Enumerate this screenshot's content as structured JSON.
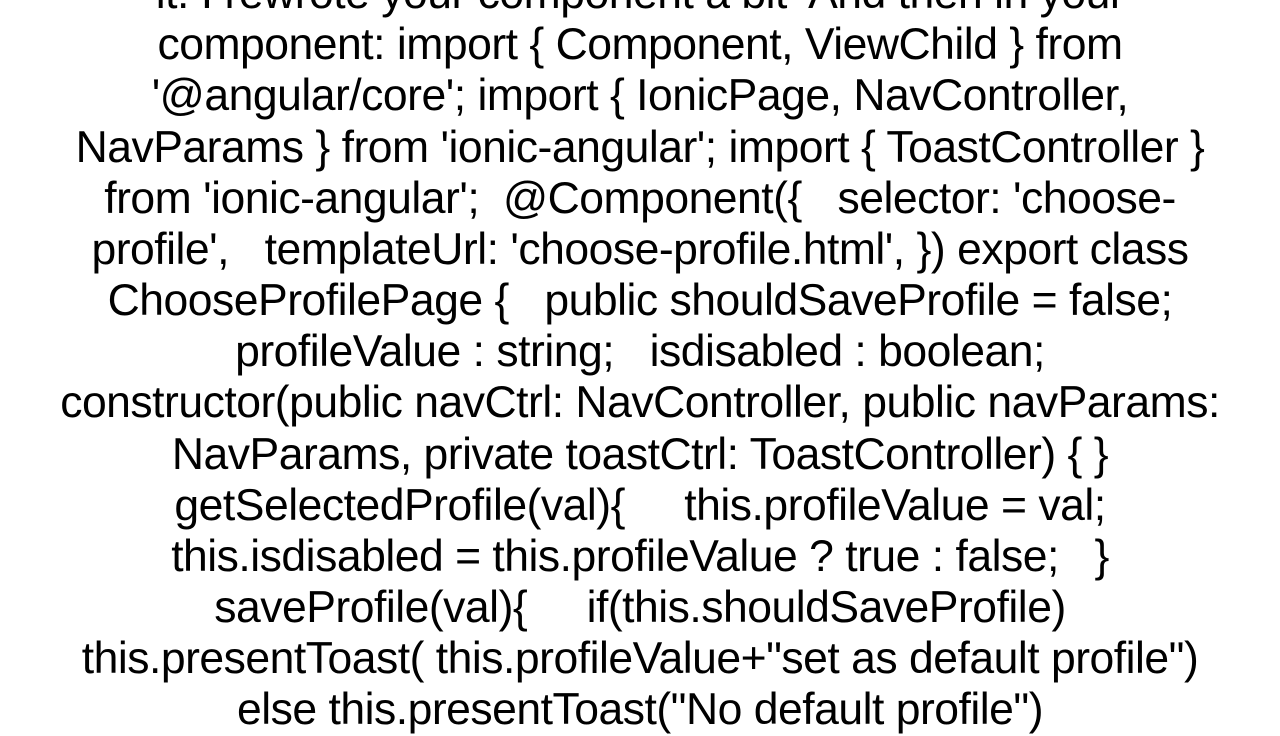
{
  "content": {
    "text": "it. I rewrote your component a bit  And then in your component: import { Component, ViewChild } from '@angular/core'; import { IonicPage, NavController, NavParams } from 'ionic-angular'; import { ToastController } from 'ionic-angular';  @Component({   selector: 'choose-profile',   templateUrl: 'choose-profile.html', }) export class ChooseProfilePage {   public shouldSaveProfile = false;   profileValue : string;   isdisabled : boolean;   constructor(public navCtrl: NavController, public navParams: NavParams, private toastCtrl: ToastController) { }   getSelectedProfile(val){     this.profileValue = val;     this.isdisabled = this.profileValue ? true : false;   }   saveProfile(val){     if(this.shouldSaveProfile)     this.presentToast( this.profileValue+\"set as default profile\")     else this.presentToast(\"No default profile\")"
  }
}
